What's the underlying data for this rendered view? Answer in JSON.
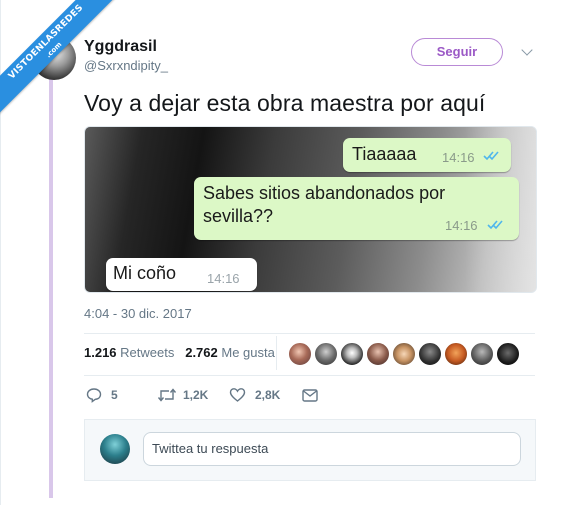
{
  "watermark": {
    "line1": "VISTOENLASREDES",
    "line2": ".com"
  },
  "user": {
    "name": "Yggdrasil",
    "handle": "@Sxrxndipity_"
  },
  "follow_label": "Seguir",
  "tweet_text": "Voy a dejar esta obra maestra por aquí",
  "chat": {
    "msg1": {
      "text": "Tiaaaaa",
      "time": "14:16"
    },
    "msg2": {
      "text_line1": "Sabes sitios abandonados por",
      "text_line2": "sevilla??",
      "time": "14:16"
    },
    "msg3": {
      "text": "Mi coño",
      "time": "14:16"
    }
  },
  "timestamp": "4:04 - 30 dic. 2017",
  "stats": {
    "retweets_count": "1.216",
    "retweets_label": "Retweets",
    "likes_count": "2.762",
    "likes_label": "Me gusta"
  },
  "actions": {
    "replies": "5",
    "retweets": "1,2K",
    "likes": "2,8K"
  },
  "reply_placeholder": "Twittea tu respuesta",
  "colors": {
    "accent_purple": "#9b59c6",
    "whatsapp_out": "#dcf8c6",
    "read_ticks": "#4fb6ec",
    "ribbon": "#2a8fe0"
  }
}
